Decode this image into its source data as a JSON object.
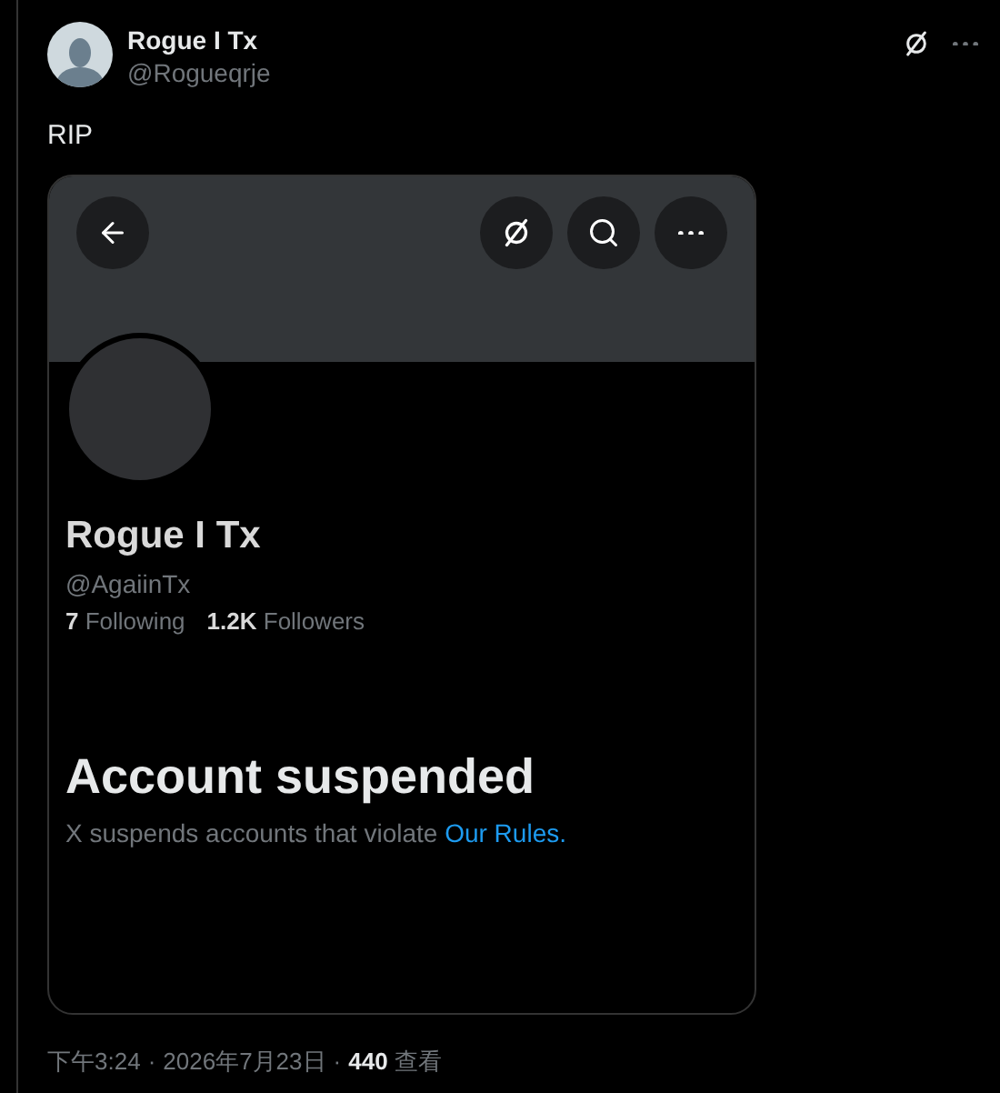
{
  "tweet": {
    "author_name": "Rogue I Tx",
    "author_handle": "@Rogueqrje",
    "text": "RIP"
  },
  "card": {
    "name": "Rogue I Tx",
    "handle": "@AgaiinTx",
    "stats": [
      {
        "count": "7",
        "label": "Following"
      },
      {
        "count": "1.2K",
        "label": "Followers"
      }
    ],
    "heading": "Account suspended",
    "message": "X suspends accounts that violate",
    "link": "Our Rules."
  },
  "footer": {
    "separator": "·",
    "time": "下午3:24",
    "date": "2026年7月23日",
    "views_count": "440",
    "views_label": "查看"
  }
}
